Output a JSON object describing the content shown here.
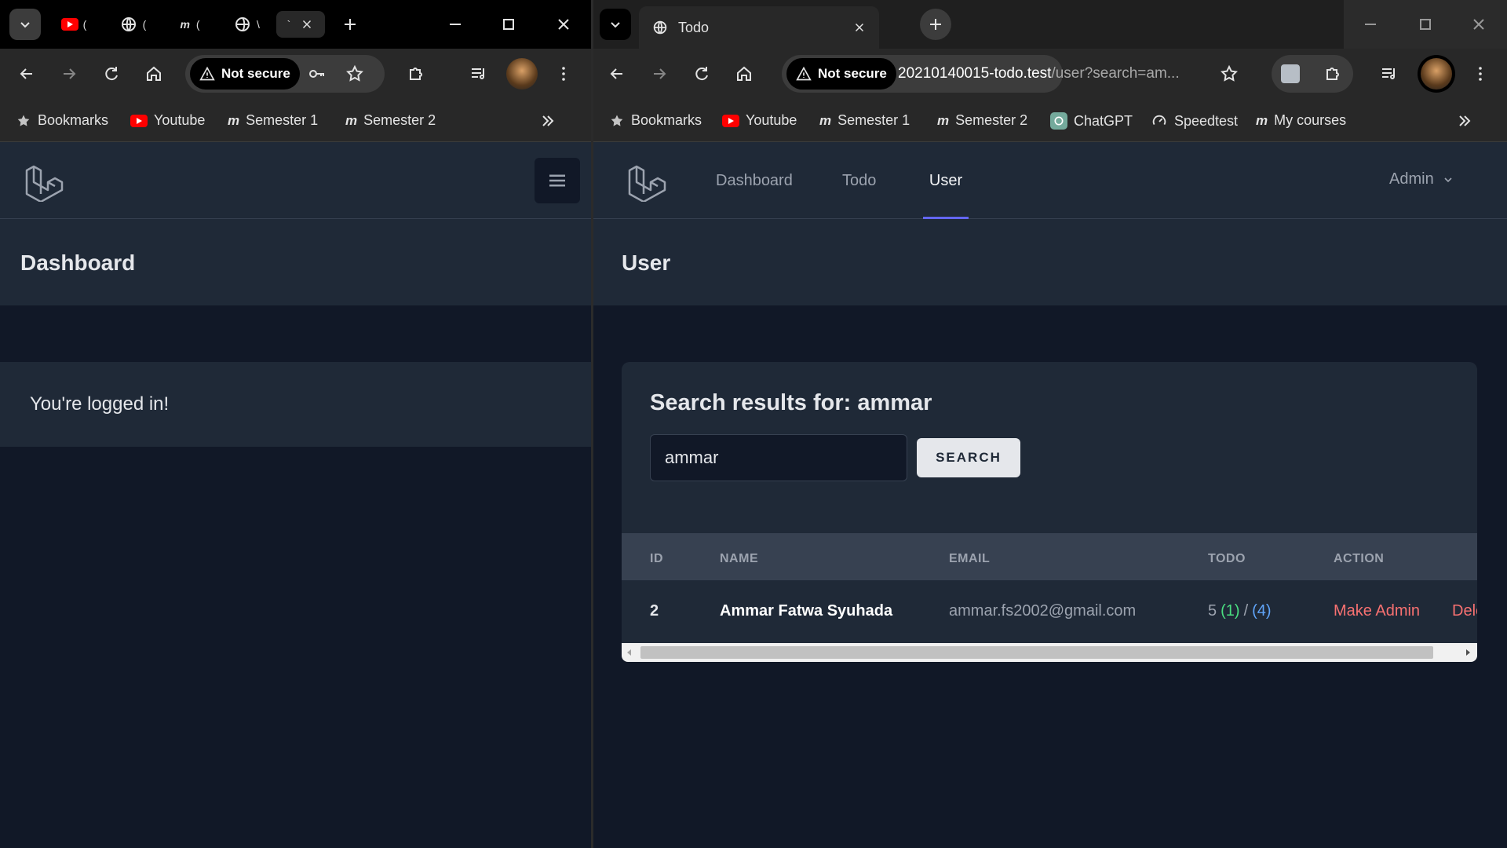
{
  "left": {
    "tabs": {
      "tab1": "(",
      "tab2": "(",
      "tab3": "(",
      "tab4": "\\",
      "tab5": "`"
    },
    "toolbar": {
      "security": "Not secure"
    },
    "bookmarks": [
      "Bookmarks",
      "Youtube",
      "Semester 1",
      "Semester 2"
    ],
    "page": {
      "title": "Dashboard",
      "message": "You're logged in!"
    }
  },
  "right": {
    "tab": {
      "title": "Todo"
    },
    "toolbar": {
      "security": "Not secure",
      "url_host": "20210140015-todo.test",
      "url_path": "/user?search=am..."
    },
    "bookmarks": [
      "Bookmarks",
      "Youtube",
      "Semester 1",
      "Semester 2",
      "ChatGPT",
      "Speedtest",
      "My courses"
    ],
    "nav": {
      "links": [
        "Dashboard",
        "Todo",
        "User"
      ],
      "active": "User",
      "user": "Admin"
    },
    "page": {
      "title": "User",
      "search_heading": "Search results for: ammar",
      "search_value": "ammar",
      "search_button": "SEARCH"
    },
    "table": {
      "headers": [
        "ID",
        "NAME",
        "EMAIL",
        "TODO",
        "ACTION"
      ],
      "rows": [
        {
          "id": "2",
          "name": "Ammar Fatwa Syuhada",
          "email": "ammar.fs2002@gmail.com",
          "todo_total": "5",
          "todo_done": "(1)",
          "todo_sep": "/",
          "todo_pending": "(4)",
          "action_primary": "Make Admin",
          "action_secondary": "Delet"
        }
      ]
    }
  },
  "colors": {
    "accent": "#6366f1",
    "done": "#4ade80",
    "pending": "#60a5fa",
    "danger": "#f87171"
  }
}
